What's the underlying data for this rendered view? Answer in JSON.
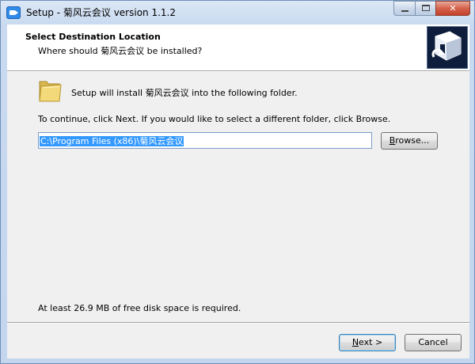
{
  "window": {
    "title": "Setup - 菊风云会议 version 1.1.2",
    "controls": {
      "minimize_icon": "minimize-icon",
      "maximize_icon": "maximize-icon",
      "close_icon": "close-icon",
      "close_glyph": "✕"
    }
  },
  "header": {
    "title": "Select Destination Location",
    "subtitle": "Where should 菊风云会议 be installed?",
    "icon": "setup-wizard-icon"
  },
  "body": {
    "install_info": "Setup will install 菊风云会议 into the following folder.",
    "instructions": "To continue, click Next. If you would like to select a different folder, click Browse.",
    "destination_path": "C:\\Program Files (x86)\\菊风云会议",
    "browse_first": "B",
    "browse_rest": "rowse...",
    "disk_space": "At least 26.9 MB of free disk space is required."
  },
  "footer": {
    "next_first": "N",
    "next_rest": "ext >",
    "cancel_label": "Cancel"
  },
  "colors": {
    "accent_blue": "#2f8ae8",
    "selection": "#3399ff",
    "wizard_icon_bg": "#0f1d3c"
  }
}
